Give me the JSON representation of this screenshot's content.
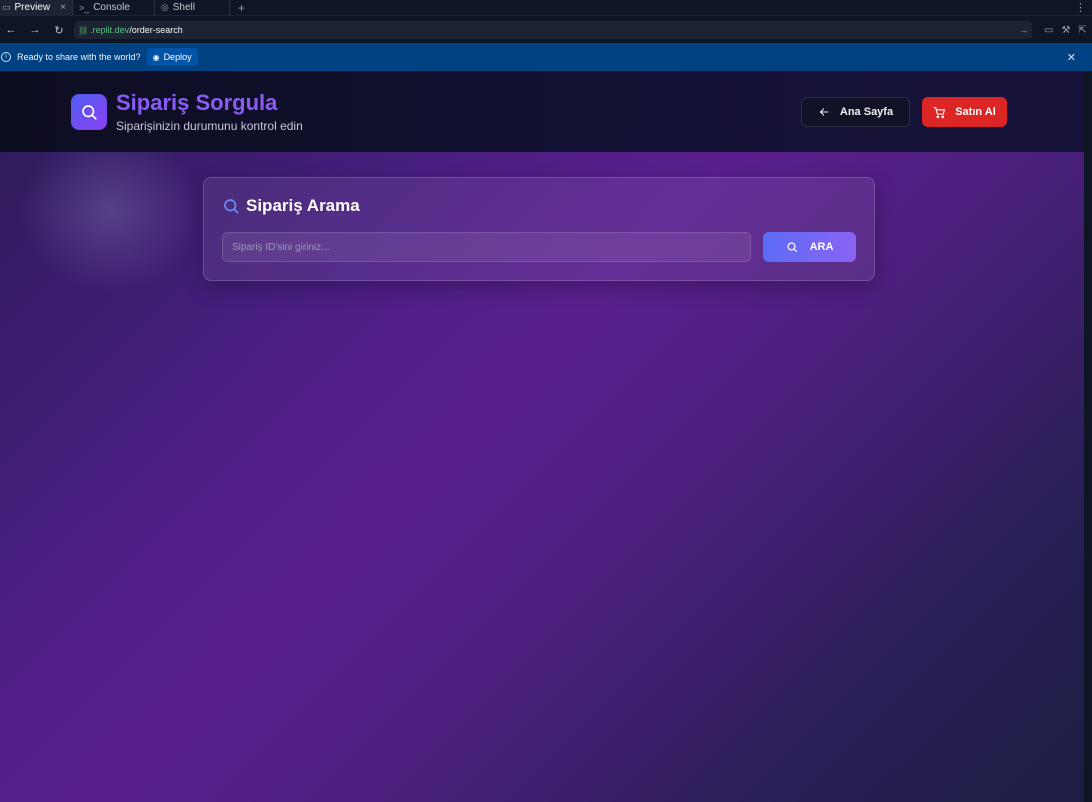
{
  "ide": {
    "tabs": [
      {
        "label": "Preview",
        "icon": "monitor-icon"
      },
      {
        "label": "Console",
        "icon": "terminal-icon"
      },
      {
        "label": "Shell",
        "icon": "shell-icon"
      }
    ],
    "url": {
      "host": ".replit.dev",
      "path": "/order-search"
    },
    "deploy_banner": {
      "message": "Ready to share with the world?",
      "button_label": "Deploy"
    }
  },
  "app": {
    "title": "Sipariş Sorgula",
    "subtitle": "Siparişinizin durumunu kontrol edin",
    "nav": {
      "home_label": "Ana Sayfa",
      "buy_label": "Satın Al"
    },
    "search": {
      "title": "Sipariş Arama",
      "placeholder": "Sipariş ID'sini giriniz...",
      "button_label": "ARA"
    }
  },
  "colors": {
    "accent": "#8a5cf6",
    "buy_button": "#dc2626",
    "deploy_banner": "#004182",
    "search_button_gradient": [
      "#5b6cf5",
      "#8a63f4"
    ]
  }
}
